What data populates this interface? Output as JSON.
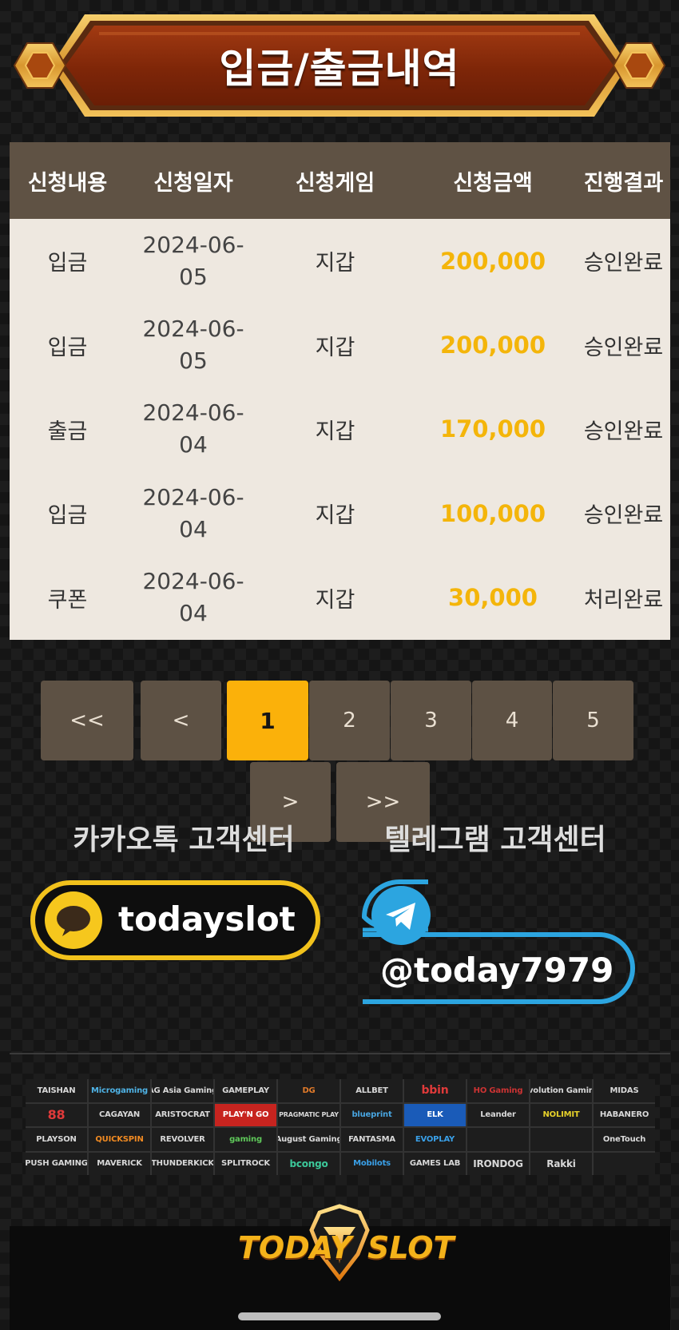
{
  "header": {
    "title": "입금/출금내역"
  },
  "table": {
    "columns": [
      "신청내용",
      "신청일자",
      "신청게임",
      "신청금액",
      "진행결과"
    ],
    "rows": [
      {
        "type": "입금",
        "date_line1": "2024-06-",
        "date_line2": "05",
        "game": "지갑",
        "amount": "200,000",
        "result": "승인완료"
      },
      {
        "type": "입금",
        "date_line1": "2024-06-",
        "date_line2": "05",
        "game": "지갑",
        "amount": "200,000",
        "result": "승인완료"
      },
      {
        "type": "출금",
        "date_line1": "2024-06-",
        "date_line2": "04",
        "game": "지갑",
        "amount": "170,000",
        "result": "승인완료"
      },
      {
        "type": "입금",
        "date_line1": "2024-06-",
        "date_line2": "04",
        "game": "지갑",
        "amount": "100,000",
        "result": "승인완료"
      },
      {
        "type": "쿠폰",
        "date_line1": "2024-06-",
        "date_line2": "04",
        "game": "지갑",
        "amount": "30,000",
        "result": "처리완료"
      }
    ]
  },
  "pagination": {
    "first": "<<",
    "prev": "<",
    "pages": [
      "1",
      "2",
      "3",
      "4",
      "5"
    ],
    "current": "1",
    "next": ">",
    "last": ">>"
  },
  "support": {
    "kakao_heading": "카카오톡 고객센터",
    "telegram_heading": "텔레그램 고객센터",
    "kakao_id": "todayslot",
    "telegram_id": "@today7979"
  },
  "providers": [
    "TAISHAN",
    "Microgaming",
    "AG Asia Gaming",
    "GAMEPLAY",
    "DG",
    "ALLBET",
    "bbin",
    "HO Gaming",
    "Evolution Gaming",
    "MIDAS",
    "88",
    "CAGAYAN",
    "ARISTOCRAT",
    "PLAY'N GO",
    "PRAGMATIC PLAY",
    "blueprint",
    "ELK",
    "Leander",
    "NOLIMIT",
    "HABANERO",
    "PLAYSON",
    "QUICKSPIN",
    "REVOLVER",
    "gaming",
    "August Gaming",
    "FANTASMA",
    "EVOPLAY",
    "",
    "",
    "OneTouch",
    "PUSH GAMING",
    "MAVERICK",
    "THUNDERKICK",
    "SPLITROCK",
    "bcongo",
    "Mobilots",
    "GAMES LAB",
    "IRONDOG",
    "Rakki",
    ""
  ],
  "brand": {
    "word1": "TODAY",
    "word2": "SLOT"
  },
  "colors": {
    "header_bg": "#5f5244",
    "amount": "#f4b50a",
    "active_page": "#fbb10a",
    "kakao": "#f2c21c",
    "telegram": "#2ca5e0",
    "banner_red": "#8b2d0c",
    "banner_gold": "#e0a33a"
  }
}
